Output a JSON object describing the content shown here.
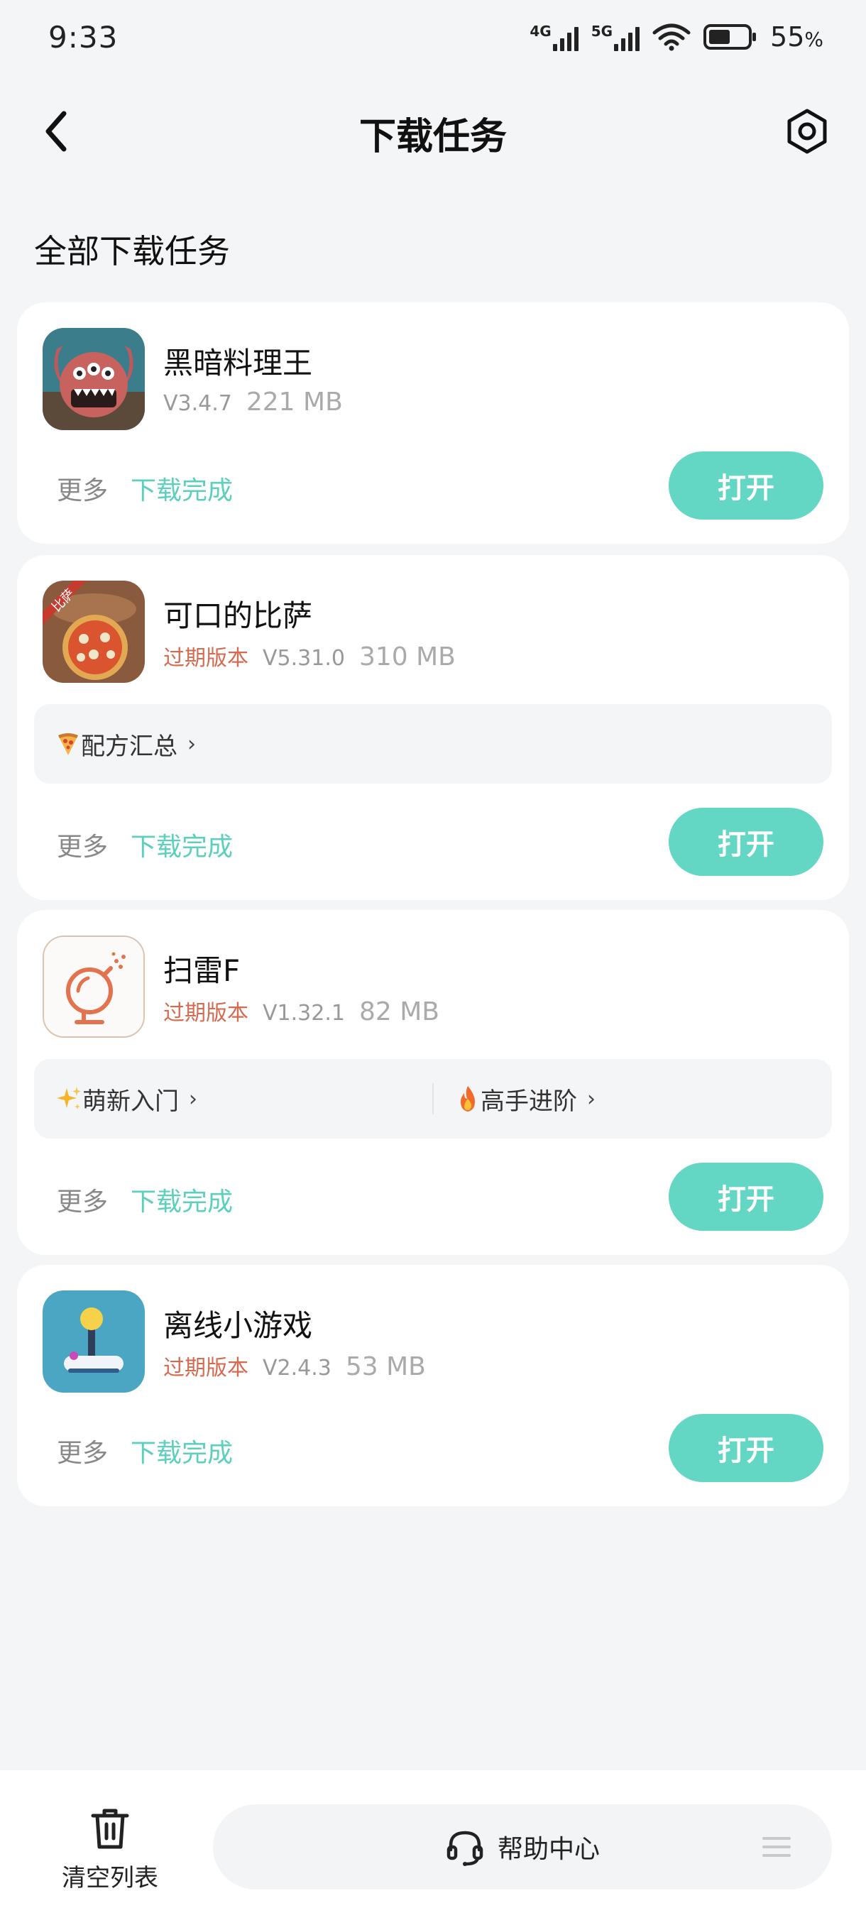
{
  "status_bar": {
    "time": "9:33",
    "signal_1": "4G",
    "signal_2": "5G",
    "battery_value": "55",
    "battery_unit": "%",
    "battery_level": 0.55
  },
  "header": {
    "title": "下载任务"
  },
  "section_title": "全部下载任务",
  "cards": [
    {
      "name": "黑暗料理王",
      "outdated": "",
      "version": "V3.4.7",
      "size": "221 MB",
      "more": "更多",
      "status": "下载完成",
      "button": "打开"
    },
    {
      "name": "可口的比萨",
      "outdated": "过期版本",
      "version": "V5.31.0",
      "size": "310 MB",
      "icon_badge": "比萨",
      "strip": [
        "配方汇总"
      ],
      "more": "更多",
      "status": "下载完成",
      "button": "打开"
    },
    {
      "name": "扫雷F",
      "outdated": "过期版本",
      "version": "V1.32.1",
      "size": "82 MB",
      "strip": [
        "萌新入门",
        "高手进阶"
      ],
      "more": "更多",
      "status": "下载完成",
      "button": "打开"
    },
    {
      "name": "离线小游戏",
      "outdated": "过期版本",
      "version": "V2.4.3",
      "size": "53 MB",
      "more": "更多",
      "status": "下载完成",
      "button": "打开"
    }
  ],
  "bottom": {
    "clear_label": "清空列表",
    "help_label": "帮助中心"
  },
  "colors": {
    "accent": "#63d6c4",
    "status_text": "#5ccfbd",
    "outdated": "#d46a4f",
    "background": "#f4f5f7"
  }
}
